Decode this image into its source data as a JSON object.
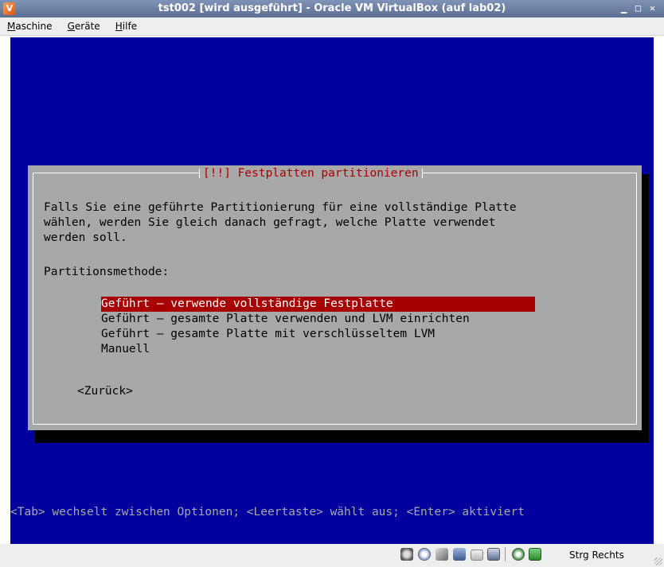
{
  "window": {
    "title": "tst002 [wird ausgeführt] - Oracle VM VirtualBox (auf lab02)",
    "app_icon": "virtualbox-icon",
    "controls": [
      "minimize-icon",
      "maximize-icon",
      "close-icon"
    ]
  },
  "menu": {
    "items": [
      "Maschine",
      "Geräte",
      "Hilfe"
    ]
  },
  "installer": {
    "dialog_title": "[!!] Festplatten partitionieren",
    "description": [
      "Falls Sie eine geführte Partitionierung für eine vollständige Platte",
      "wählen, werden Sie gleich danach gefragt, welche Platte verwendet",
      "werden soll."
    ],
    "prompt_label": "Partitionsmethode:",
    "options": [
      "Geführt – verwende vollständige Festplatte",
      "Geführt – gesamte Platte verwenden und LVM einrichten",
      "Geführt – gesamte Platte mit verschlüsseltem LVM",
      "Manuell"
    ],
    "selected_option": "Geführt – verwende vollständige Festplatte",
    "back_button": "<Zurück>",
    "help_line": "<Tab> wechselt zwischen Optionen; <Leertaste> wählt aus; <Enter> aktiviert"
  },
  "statusbar": {
    "icons": [
      "harddisk-icon",
      "optical-drive-icon",
      "usb-icon",
      "network-icon",
      "shared-folders-icon",
      "display-icon",
      "guest-additions-icon",
      "mouse-integration-icon"
    ],
    "host_key": "Strg Rechts"
  },
  "colors": {
    "screen_background": "#00009f",
    "dialog_background": "#a8a8a8",
    "selection": "#a80000",
    "title_text": "#a80000"
  }
}
